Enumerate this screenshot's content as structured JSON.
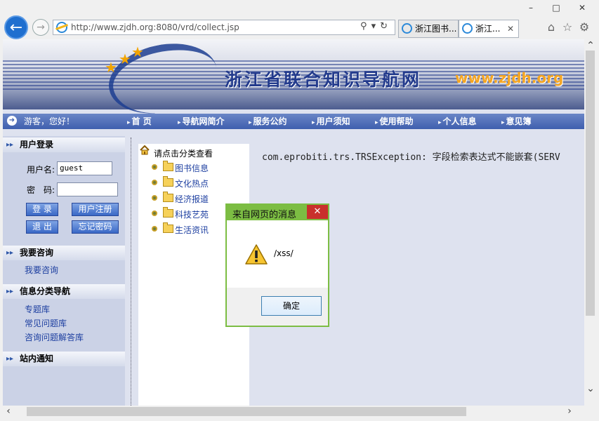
{
  "browser": {
    "window_controls": [
      "–",
      "□",
      "✕"
    ],
    "url": "http://www.zjdh.org:8080/vrd/collect.jsp",
    "tabs": [
      {
        "title": "浙江图书..."
      },
      {
        "title": "浙江...",
        "close": "✕"
      }
    ],
    "toolbar_icons": [
      "home-icon",
      "star-icon",
      "gear-icon"
    ]
  },
  "banner": {
    "title": "浙江省联合知识导航网",
    "url_text": "www.zjdh.org"
  },
  "nav": {
    "greeting": "游客，您好！",
    "links": [
      "首 页",
      "导航网简介",
      "服务公约",
      "用户须知",
      "使用帮助",
      "个人信息",
      "意见簿"
    ]
  },
  "sidebar": {
    "login_title": "用户登录",
    "username_label": "用户名:",
    "username_value": "guest",
    "password_label": "密　码:",
    "login_button": "登 录",
    "register_button": "用户注册",
    "logout_button": "退 出",
    "forgot_button": "忘记密码",
    "consult_title": "我要咨询",
    "consult_link": "我要咨询",
    "nav_title": "信息分类导航",
    "nav_links": [
      "专题库",
      "常见问题库",
      "咨询问题解答库"
    ],
    "notice_title": "站内通知"
  },
  "tree": {
    "title": "请点击分类查看",
    "items": [
      "图书信息",
      "文化热点",
      "经济报道",
      "科技艺苑",
      "生活资讯"
    ]
  },
  "error_text": "com.eprobiti.trs.TRSException: 字段检索表达式不能嵌套(SERV",
  "dialog": {
    "title": "来自网页的消息",
    "message": "/xss/",
    "ok_label": "确定",
    "close": "✕"
  },
  "colors": {
    "nav_bar": "#3f5fae",
    "dialog_frame": "#7cbd43",
    "dialog_close": "#c9302c",
    "link": "#1d3fa0"
  }
}
